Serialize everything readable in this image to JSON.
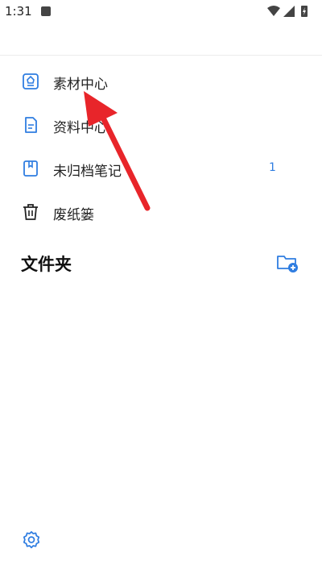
{
  "status_bar": {
    "time": "1:31"
  },
  "nav": {
    "items": [
      {
        "label": "素材中心",
        "icon": "material-center-icon",
        "badge": ""
      },
      {
        "label": "资料中心",
        "icon": "document-icon",
        "badge": ""
      },
      {
        "label": "未归档笔记",
        "icon": "bookmark-notebook-icon",
        "badge": "1"
      },
      {
        "label": "废纸篓",
        "icon": "trash-icon",
        "badge": ""
      }
    ]
  },
  "folders": {
    "title": "文件夹",
    "add_icon": "add-folder-icon"
  },
  "footer": {
    "settings_icon": "gear-icon"
  },
  "colors": {
    "accent": "#2f7de1",
    "arrow": "#e8252a",
    "text": "#222222"
  }
}
